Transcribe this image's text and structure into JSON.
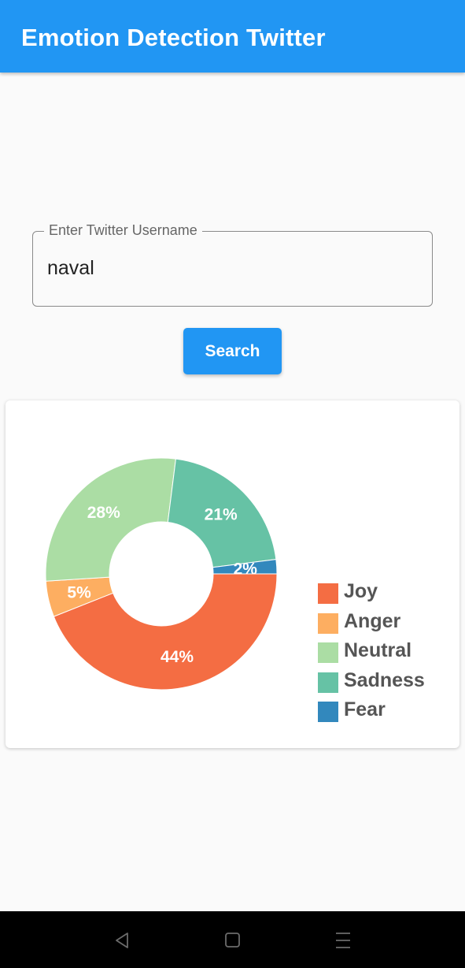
{
  "app": {
    "title": "Emotion Detection Twitter"
  },
  "search": {
    "field_label": "Enter Twitter Username",
    "value": "naval",
    "button_label": "Search"
  },
  "chart_data": {
    "type": "pie",
    "donut": true,
    "legend_position": "right",
    "slices": [
      {
        "label": "Joy",
        "value": 44,
        "display": "44%",
        "color": "#f46d43"
      },
      {
        "label": "Anger",
        "value": 5,
        "display": "5%",
        "color": "#fdae61"
      },
      {
        "label": "Neutral",
        "value": 28,
        "display": "28%",
        "color": "#abdda4"
      },
      {
        "label": "Sadness",
        "value": 21,
        "display": "21%",
        "color": "#66c2a5"
      },
      {
        "label": "Fear",
        "value": 2,
        "display": "2%",
        "color": "#3288bd"
      }
    ]
  },
  "system_nav": {
    "icons": [
      "back-icon",
      "home-icon",
      "menu-icon"
    ]
  },
  "colors": {
    "primary": "#2196f3",
    "background": "#fafafa",
    "legend_text": "#555555"
  }
}
